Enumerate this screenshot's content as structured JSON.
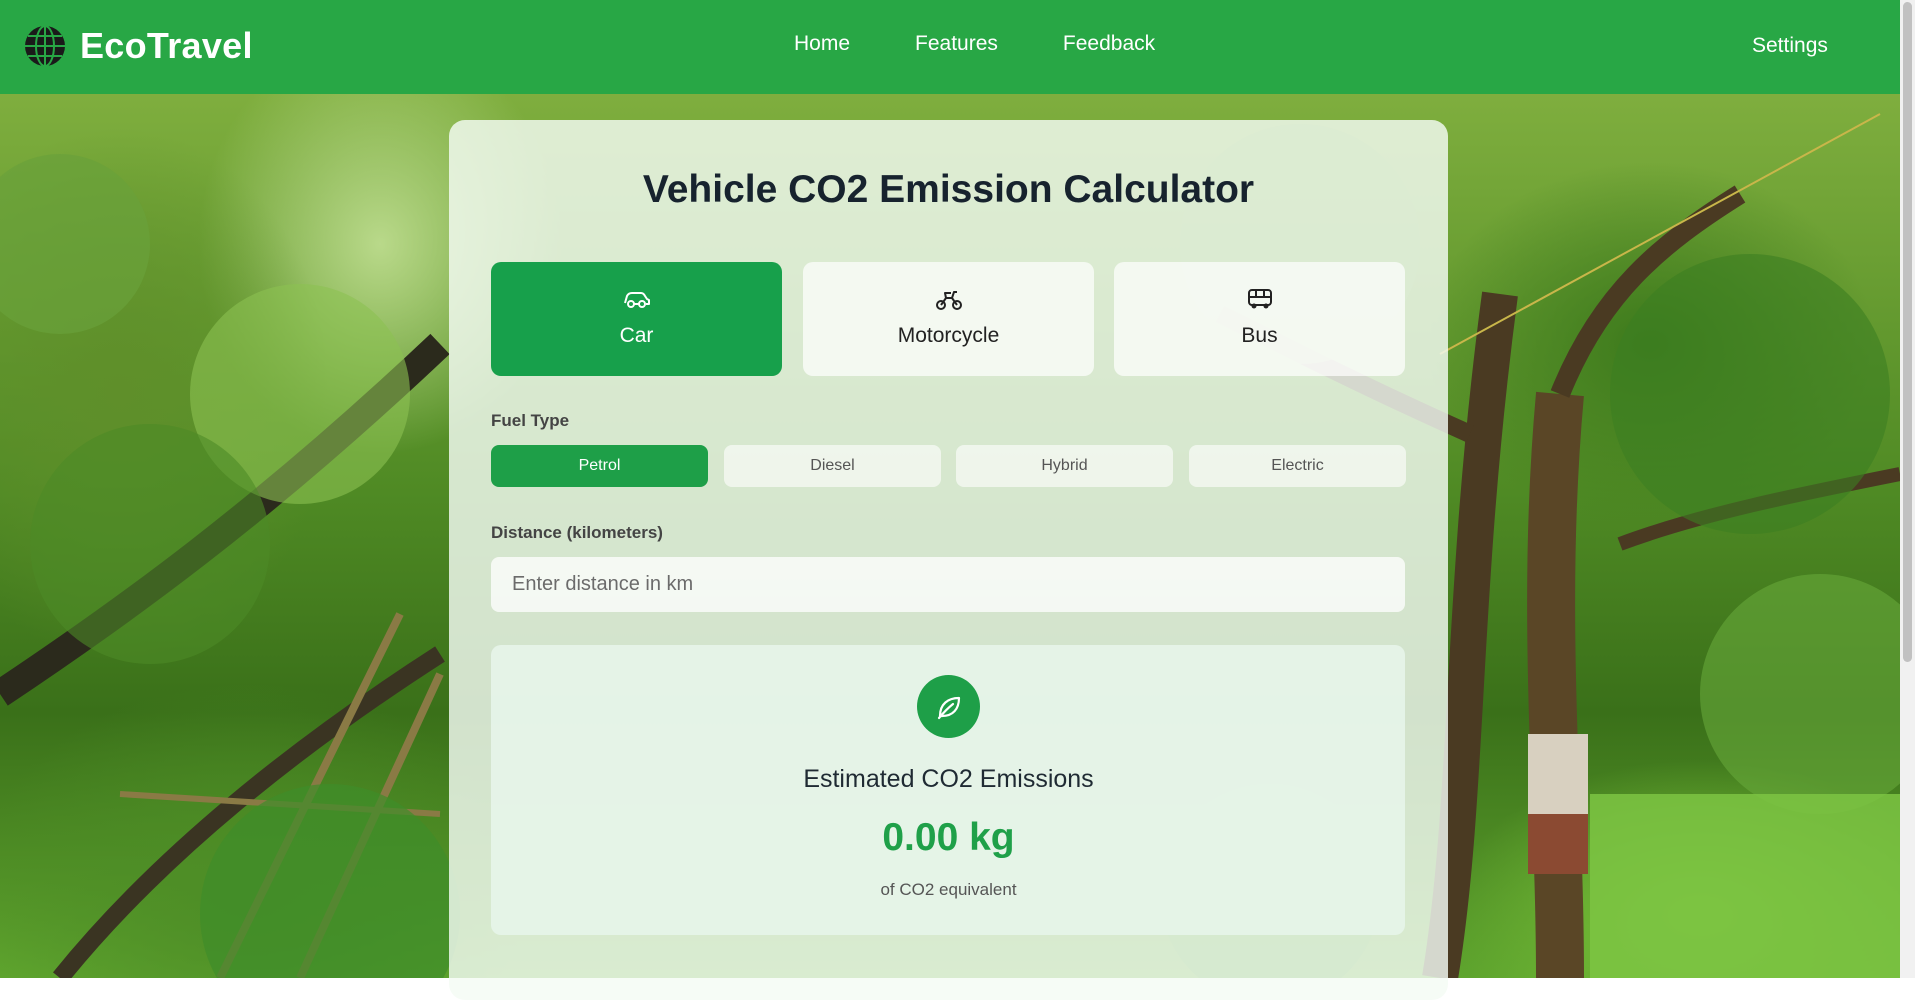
{
  "header": {
    "brand": "EcoTravel",
    "nav": [
      "Home",
      "Features",
      "Feedback"
    ],
    "settings": "Settings"
  },
  "calculator": {
    "title": "Vehicle CO2 Emission Calculator",
    "vehicles": [
      {
        "label": "Car",
        "icon": "car-icon",
        "selected": true
      },
      {
        "label": "Motorcycle",
        "icon": "motorcycle-icon",
        "selected": false
      },
      {
        "label": "Bus",
        "icon": "bus-icon",
        "selected": false
      }
    ],
    "fuel_label": "Fuel Type",
    "fuels": [
      {
        "label": "Petrol",
        "selected": true
      },
      {
        "label": "Diesel",
        "selected": false
      },
      {
        "label": "Hybrid",
        "selected": false
      },
      {
        "label": "Electric",
        "selected": false
      }
    ],
    "distance_label": "Distance (kilometers)",
    "distance_placeholder": "Enter distance in km",
    "distance_value": ""
  },
  "result": {
    "icon": "leaf-icon",
    "title": "Estimated CO2 Emissions",
    "value": "0.00 kg",
    "subtitle": "of CO2 equivalent"
  },
  "colors": {
    "header": "#28a745",
    "accent": "#1e9f48",
    "title": "#17232e"
  }
}
